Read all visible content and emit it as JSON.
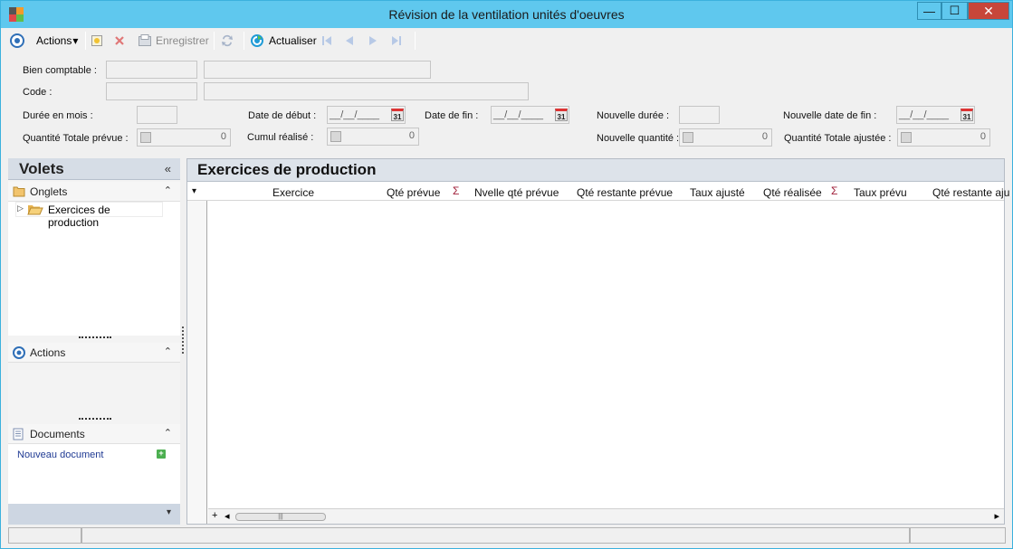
{
  "window": {
    "title": "Révision de la ventilation unités d'oeuvres",
    "min_glyph": "—",
    "max_glyph": "☐",
    "close_glyph": "✕"
  },
  "toolbar": {
    "actions_label": "Actions",
    "actions_caret": "▾",
    "save_label": "Enregistrer",
    "refresh_label": "Actualiser"
  },
  "form": {
    "bien_comptable_label": "Bien comptable :",
    "code_label": "Code :",
    "duree_mois_label": "Durée en mois :",
    "date_debut_label": "Date de début :",
    "date_debut_value": "__/__/____",
    "date_fin_label": "Date de fin :",
    "date_fin_value": "__/__/____",
    "nouvelle_duree_label": "Nouvelle durée :",
    "nouvelle_date_fin_label": "Nouvelle date de fin :",
    "nouvelle_date_fin_value": "__/__/____",
    "qte_totale_prevue_label": "Quantité Totale prévue :",
    "qte_totale_prevue_value": "0",
    "cumul_realise_label": "Cumul réalisé :",
    "cumul_realise_value": "0",
    "nouvelle_quantite_label": "Nouvelle quantité :",
    "nouvelle_quantite_value": "0",
    "qte_totale_ajustee_label": "Quantité Totale ajustée :",
    "qte_totale_ajustee_value": "0",
    "calendar_glyph": "31"
  },
  "volets": {
    "title": "Volets",
    "collapse_glyph": "«",
    "section_collapse_glyph": "⌃",
    "onglets_label": "Onglets",
    "tree_item": "Exercices de production",
    "actions_label": "Actions",
    "documents_label": "Documents",
    "new_document_link": "Nouveau document",
    "bottom_glyph": "▾"
  },
  "main": {
    "title": "Exercices de production",
    "columns": [
      "Exercice",
      "Qté prévue",
      "Nvelle qté prévue",
      "Qté restante prévue",
      "Taux ajusté",
      "Qté réalisée",
      "Taux prévu",
      "Qté restante aju"
    ],
    "sigma": "Σ",
    "row_menu_glyph": "▾",
    "add_glyph": "+",
    "scroll_left": "◂",
    "scroll_right": "▸",
    "thumb_grip": "|||"
  },
  "colors": {
    "titlebar": "#5fc8ee",
    "close_button": "#c7463a",
    "panel_header": "#dde3ea",
    "sigma": "#a0203a",
    "link": "#1f3a93"
  }
}
